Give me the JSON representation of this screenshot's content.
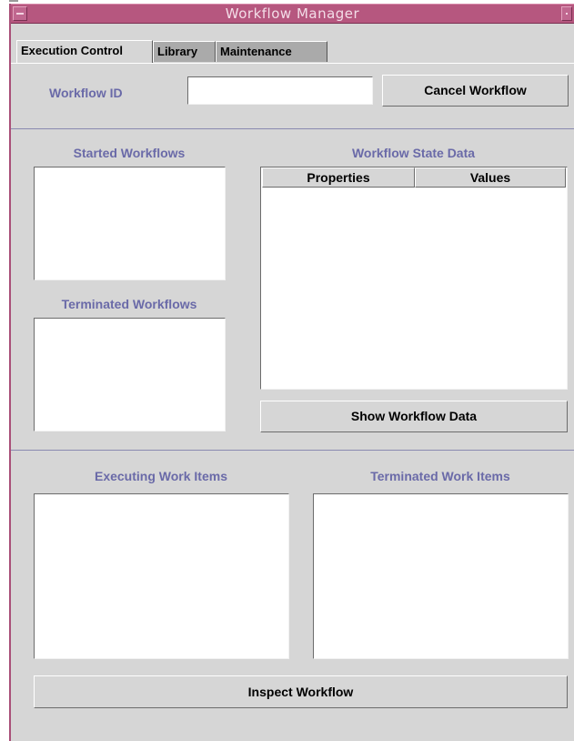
{
  "window": {
    "title": "Workflow Manager"
  },
  "tabs": [
    {
      "label": "Execution Control",
      "active": true
    },
    {
      "label": "Library",
      "active": false
    },
    {
      "label": "Maintenance",
      "active": false
    }
  ],
  "workflow_id": {
    "label": "Workflow ID",
    "value": "",
    "placeholder": ""
  },
  "buttons": {
    "cancel": "Cancel Workflow",
    "show_data": "Show Workflow Data",
    "inspect": "Inspect Workflow"
  },
  "panels": {
    "started": "Started Workflows",
    "terminated": "Terminated Workflows",
    "state_data": "Workflow State Data",
    "executing_items": "Executing Work Items",
    "terminated_items": "Terminated Work Items"
  },
  "state_table": {
    "columns": [
      "Properties",
      "Values"
    ],
    "rows": []
  },
  "colors": {
    "titlebar": "#b6577f",
    "label_text": "#6a6aa8",
    "background": "#d6d6d6"
  }
}
